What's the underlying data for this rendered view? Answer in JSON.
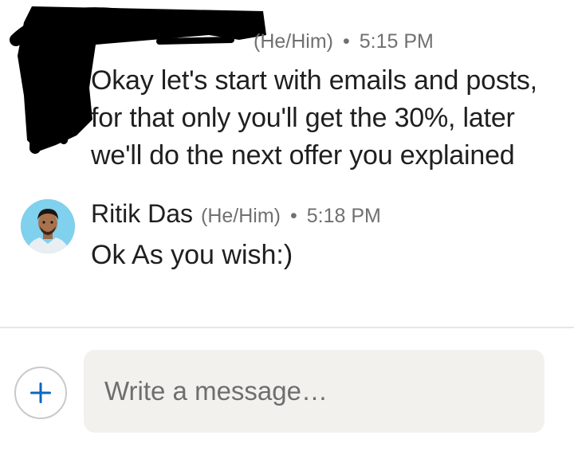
{
  "message_1": {
    "sender_name_visible": "",
    "pronouns_fragment": "(He/Him)",
    "separator": "•",
    "time": "5:15 PM",
    "lines": [
      "Okay let's start with emails and posts,",
      "for that only you'll get the 30%, later",
      "we'll do the next offer you explained"
    ]
  },
  "message_2": {
    "sender_name": "Ritik Das",
    "pronouns": "(He/Him)",
    "separator": "•",
    "time": "5:18 PM",
    "text": "Ok As you wish:)"
  },
  "composer": {
    "placeholder": "Write a message…",
    "add_icon": "plus-icon"
  },
  "colors": {
    "accent_blue": "#0a66c2",
    "text_primary": "#1f1f1f",
    "text_secondary": "#707070",
    "composer_bg": "#f2f1ee",
    "avatar_bg": "#7fd1ee",
    "redaction": "#000000"
  }
}
